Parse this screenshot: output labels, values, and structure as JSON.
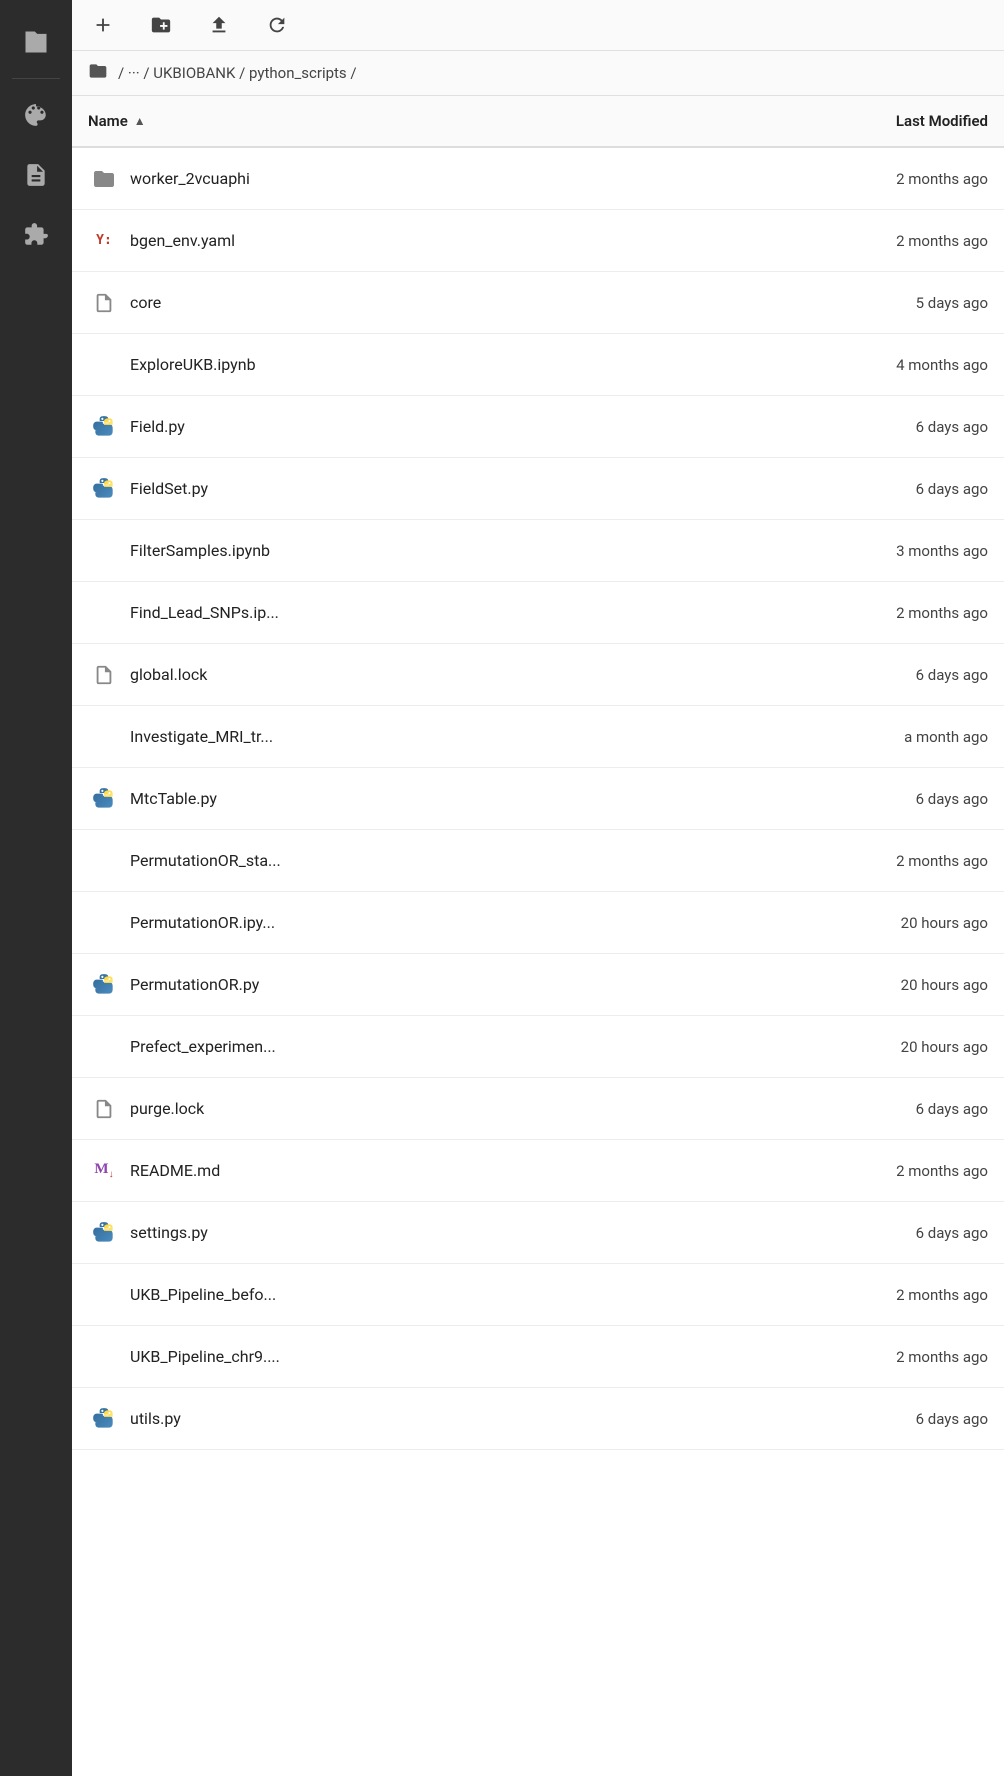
{
  "toolbar": {
    "new_file_label": "+",
    "new_folder_label": "📁+",
    "upload_label": "⬆",
    "refresh_label": "↺"
  },
  "breadcrumb": {
    "root": "/",
    "sep1": "···",
    "part1": "UKBIOBANK",
    "part2": "python_scripts",
    "trail": "/ ··· / UKBIOBANK / python_scripts /"
  },
  "table": {
    "col_name": "Name",
    "col_modified": "Last Modified",
    "sort_arrow": "▲",
    "files": [
      {
        "name": "worker_2vcuaphi",
        "modified": "2 months ago",
        "icon": "folder",
        "truncated": false
      },
      {
        "name": "bgen_env.yaml",
        "modified": "2 months ago",
        "icon": "yaml",
        "truncated": false
      },
      {
        "name": "core",
        "modified": "5 days ago",
        "icon": "generic",
        "truncated": false
      },
      {
        "name": "ExploreUKB.ipynb",
        "modified": "4 months ago",
        "icon": "none",
        "truncated": false
      },
      {
        "name": "Field.py",
        "modified": "6 days ago",
        "icon": "python",
        "truncated": false
      },
      {
        "name": "FieldSet.py",
        "modified": "6 days ago",
        "icon": "python",
        "truncated": false
      },
      {
        "name": "FilterSamples.ipynb",
        "modified": "3 months ago",
        "icon": "none",
        "truncated": false
      },
      {
        "name": "Find_Lead_SNPs.ip...",
        "modified": "2 months ago",
        "icon": "none",
        "truncated": true
      },
      {
        "name": "global.lock",
        "modified": "6 days ago",
        "icon": "generic",
        "truncated": false
      },
      {
        "name": "Investigate_MRI_tr...",
        "modified": "a month ago",
        "icon": "none",
        "truncated": true
      },
      {
        "name": "MtcTable.py",
        "modified": "6 days ago",
        "icon": "python",
        "truncated": false
      },
      {
        "name": "PermutationOR_sta...",
        "modified": "2 months ago",
        "icon": "none",
        "truncated": true
      },
      {
        "name": "PermutationOR.ipy...",
        "modified": "20 hours ago",
        "icon": "none",
        "truncated": true
      },
      {
        "name": "PermutationOR.py",
        "modified": "20 hours ago",
        "icon": "python",
        "truncated": false
      },
      {
        "name": "Prefect_experimen...",
        "modified": "20 hours ago",
        "icon": "none",
        "truncated": true
      },
      {
        "name": "purge.lock",
        "modified": "6 days ago",
        "icon": "generic",
        "truncated": false
      },
      {
        "name": "README.md",
        "modified": "2 months ago",
        "icon": "markdown",
        "truncated": false
      },
      {
        "name": "settings.py",
        "modified": "6 days ago",
        "icon": "python",
        "truncated": false
      },
      {
        "name": "UKB_Pipeline_befo...",
        "modified": "2 months ago",
        "icon": "none",
        "truncated": true
      },
      {
        "name": "UKB_Pipeline_chr9....",
        "modified": "2 months ago",
        "icon": "none",
        "truncated": true
      },
      {
        "name": "utils.py",
        "modified": "6 days ago",
        "icon": "python",
        "truncated": false
      }
    ]
  },
  "sidebar": {
    "items": [
      {
        "icon": "folder",
        "label": "Files"
      },
      {
        "icon": "palette",
        "label": "Themes"
      },
      {
        "icon": "page",
        "label": "Pages"
      },
      {
        "icon": "puzzle",
        "label": "Extensions"
      }
    ]
  }
}
